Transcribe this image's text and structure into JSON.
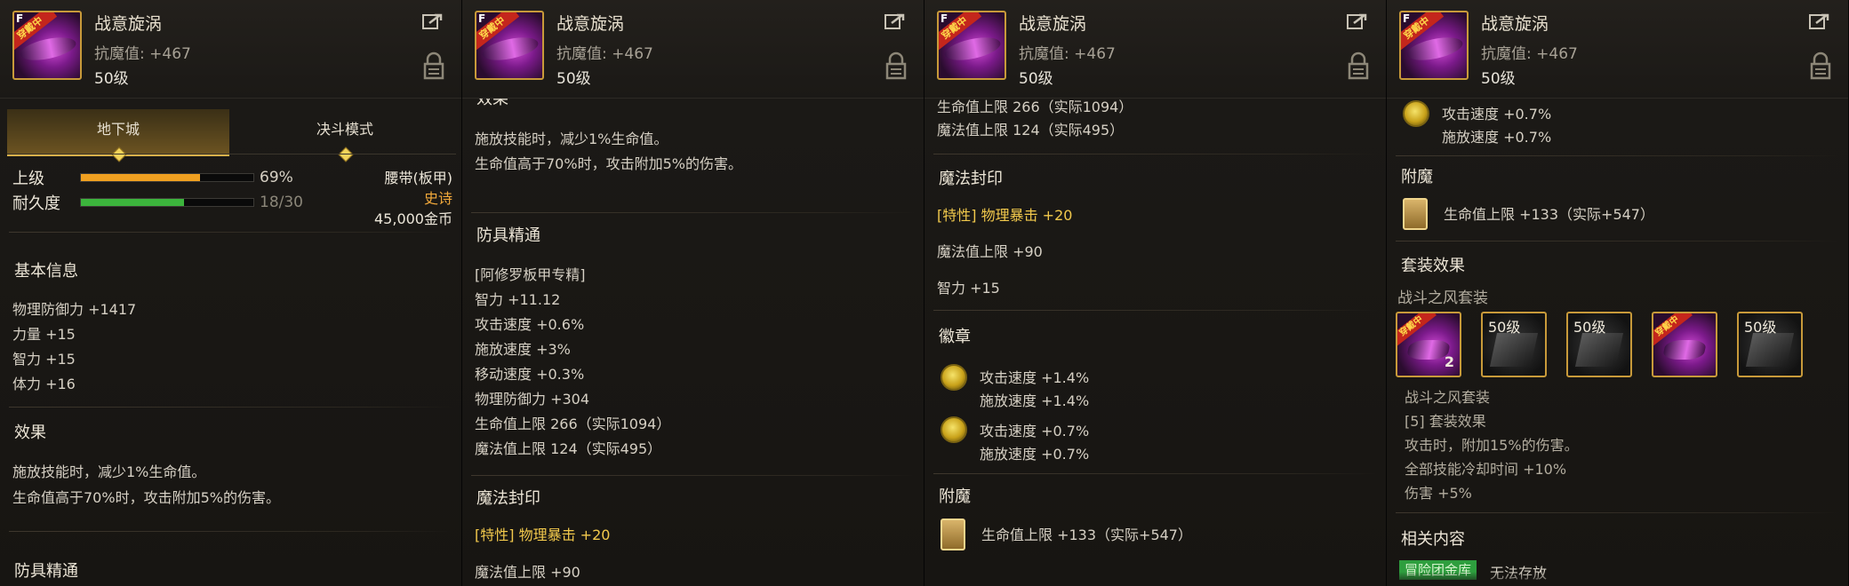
{
  "item": {
    "name": "战意旋涡",
    "magic_resist": "抗魔值: +467",
    "level": "50级",
    "equipped_ribbon": "穿戴中",
    "f_key": "F"
  },
  "tabs": [
    {
      "label": "地下城",
      "active": true
    },
    {
      "label": "决斗模式",
      "active": false
    }
  ],
  "bars": [
    {
      "label": "上级",
      "value_text": "69%",
      "fill": 0.69,
      "color": "#f0a020"
    },
    {
      "label": "耐久度",
      "value_text": "18/30",
      "fill": 0.6,
      "color": "#3cb43c"
    }
  ],
  "item_meta": {
    "type": "腰带(板甲)",
    "rarity": "史诗",
    "price": "45,000金币",
    "rarity_color": "#f2a93b"
  },
  "basic_info": {
    "title": "基本信息",
    "lines": [
      "物理防御力 +1417",
      "力量 +15",
      "智力 +15",
      "体力 +16"
    ]
  },
  "effect": {
    "title": "效果",
    "cut_title": "效果",
    "lines": [
      "施放技能时，减少1%生命值。",
      "生命值高于70%时，攻击附加5%的伤害。"
    ]
  },
  "armor_mastery": {
    "title": "防具精通",
    "spec": "[阿修罗板甲专精]",
    "lines": [
      "智力 +11.12",
      "攻击速度 +0.6%",
      "施放速度 +3%",
      "移动速度 +0.3%",
      "物理防御力 +304",
      "生命值上限 266（实际1094）",
      "魔法值上限 124（实际495）"
    ]
  },
  "magic_seal": {
    "title": "魔法封印",
    "special": "[特性] 物理暴击 +20",
    "lines": [
      "魔法值上限 +90",
      "智力 +15"
    ]
  },
  "emblem": {
    "title": "徽章",
    "groups": [
      [
        "攻击速度 +1.4%",
        "施放速度 +1.4%"
      ],
      [
        "攻击速度 +0.7%",
        "施放速度 +0.7%"
      ]
    ]
  },
  "enchant": {
    "title": "附魔",
    "line": "生命值上限 +133（实际+547）"
  },
  "set_effect": {
    "title": "套装效果",
    "set_name": "战斗之风套装",
    "slots": [
      {
        "label": "",
        "ribbon": "穿戴中",
        "purple": true,
        "count": "2"
      },
      {
        "label": "50级",
        "ribbon": "",
        "purple": false
      },
      {
        "label": "50级",
        "ribbon": "",
        "purple": false
      },
      {
        "label": "",
        "ribbon": "穿戴中",
        "purple": true
      },
      {
        "label": "50级",
        "ribbon": "",
        "purple": false
      }
    ],
    "detail_name": "战斗之风套装",
    "detail_lines": [
      "[5] 套装效果",
      "攻击时，附加15%的伤害。",
      "全部技能冷却时间 +10%",
      "伤害 +5%"
    ]
  },
  "related": {
    "title": "相关内容",
    "badge": "冒险团金库",
    "text": "无法存放"
  }
}
